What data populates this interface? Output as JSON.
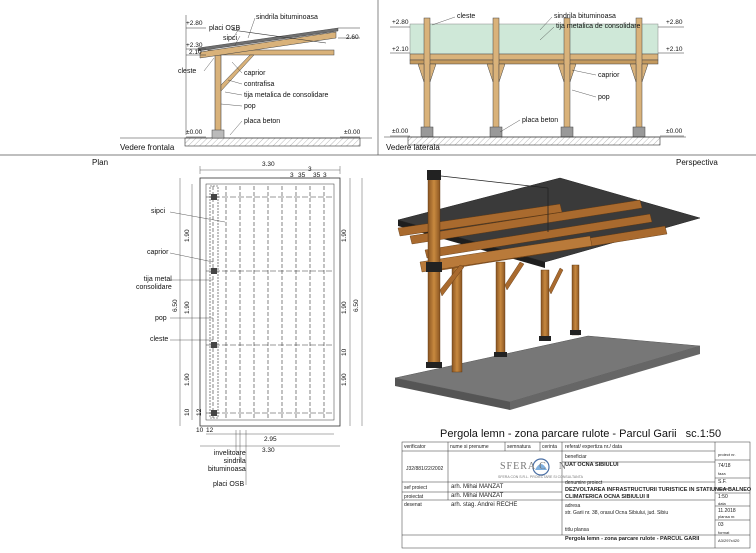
{
  "front": {
    "section": "Vedere frontala",
    "levels": {
      "l280": "+2.80",
      "l260": "2.60",
      "l230": "+2.30",
      "l210": "2.10",
      "l000a": "±0.00",
      "l000b": "±0.00"
    },
    "labels": {
      "sindrila": "sindrila bituminoasa",
      "placi_osb": "placi OSB",
      "sipci": "sipci",
      "cleste": "cleste",
      "caprior": "caprior",
      "contrafisa": "contrafisa",
      "tija": "tija metalica de consolidare",
      "pop": "pop",
      "placa": "placa beton"
    }
  },
  "side": {
    "section": "Vedere laterala",
    "levels": {
      "l280a": "+2.80",
      "l280b": "+2.80",
      "l210a": "+2.10",
      "l210b": "+2.10",
      "l000a": "±0.00",
      "l000b": "±0.00"
    },
    "labels": {
      "cleste": "cleste",
      "sindrila": "sindrila bituminoasa",
      "tija": "tija metalica de consolidare",
      "caprior": "caprior",
      "pop": "pop",
      "placa": "placa beton"
    }
  },
  "plan": {
    "section": "Plan",
    "dims": {
      "top": "3.30",
      "top_small1": "3",
      "top_small2": "35",
      "top_small3": "3",
      "top_small4": "35",
      "top_small5": "3",
      "left_total": "6.50",
      "left_a": "1.90",
      "left_b": "1.90",
      "left_c": "1.90",
      "left_d": "10",
      "left_e": "12",
      "right_total": "6.50",
      "right_a": "1.90",
      "right_b": "1.90",
      "right_c": "1.90",
      "right_d": "10",
      "bottom_inner": "2.95",
      "bottom_outer": "3.30",
      "bottom_small1": "12",
      "bottom_small2": "10"
    },
    "labels": {
      "sipci": "sipci",
      "caprior": "caprior",
      "tija": "tija metal\nconsolidare",
      "pop": "pop",
      "cleste": "cleste",
      "invelitoare": "invelitoare\nsindrila\nbituminoasa",
      "placi_osb": "placi OSB"
    }
  },
  "perspective": {
    "section": "Perspectiva"
  },
  "title": {
    "main": "Pergola lemn - zona parcare rulote - Parcul Garii",
    "scale": "sc.1:50"
  },
  "titleblock": {
    "h_verificator": "verificator",
    "h_nume": "nume si prenume",
    "h_semnatura": "semnatura",
    "h_cerinta": "cerinta",
    "h_referat": "referat/ expertiza nr./ data",
    "company_code": "J32/881/22/2002",
    "company_name": "SFERA C",
    "company_name2": "N",
    "company_sub": "SFERA CON S.R.L. PROIECTARE SI CONSULTANTA",
    "r1_role": "sef proiect",
    "r2_role": "proiectat",
    "r3_role": "desenat",
    "r1_name": "arh. Mihai MANZAT",
    "r2_name": "arh. Mihai MANZAT",
    "r3_name": "arh. stag. Andrei RECHE",
    "beneficiar_lbl": "beneficiar",
    "beneficiar": "UAT OCNA SIBIULUI",
    "proiect_lbl": "denumire proiect",
    "proiect1": "DEZVOLTAREA INFRASTRUCTURII TURISTICE IN STATIUNEA BALNEO",
    "proiect2": "CLIMATERICA OCNA SIBIULUI II",
    "adresa_lbl": "adresa",
    "adresa": "str. Garii nr. 38, orasul Ocna Sibiului, jud. Sibiu",
    "plansa_lbl": "titlu plansa",
    "plansa": "Pergola lemn - zona parcare rulote - PARCUL GARII",
    "r_nr_lbl": "proiect nr.",
    "r_nr": "74/18",
    "r_faza_lbl": "faza",
    "r_faza": "S.F.",
    "r_scara_lbl": "scara",
    "r_scara": "1:50",
    "r_data_lbl": "data",
    "r_data": "11.2018",
    "r_plansa_lbl": "plansa nr.",
    "r_plansa": "03",
    "r_nr2_lbl": "format",
    "r_nr2": "A3/297x420"
  },
  "colors": {
    "wood": "#b97a3a",
    "wood_dark": "#8a5522",
    "concrete": "#6e6e6e",
    "roof": "#3a3a3a",
    "glass": "#cfe8d8"
  }
}
